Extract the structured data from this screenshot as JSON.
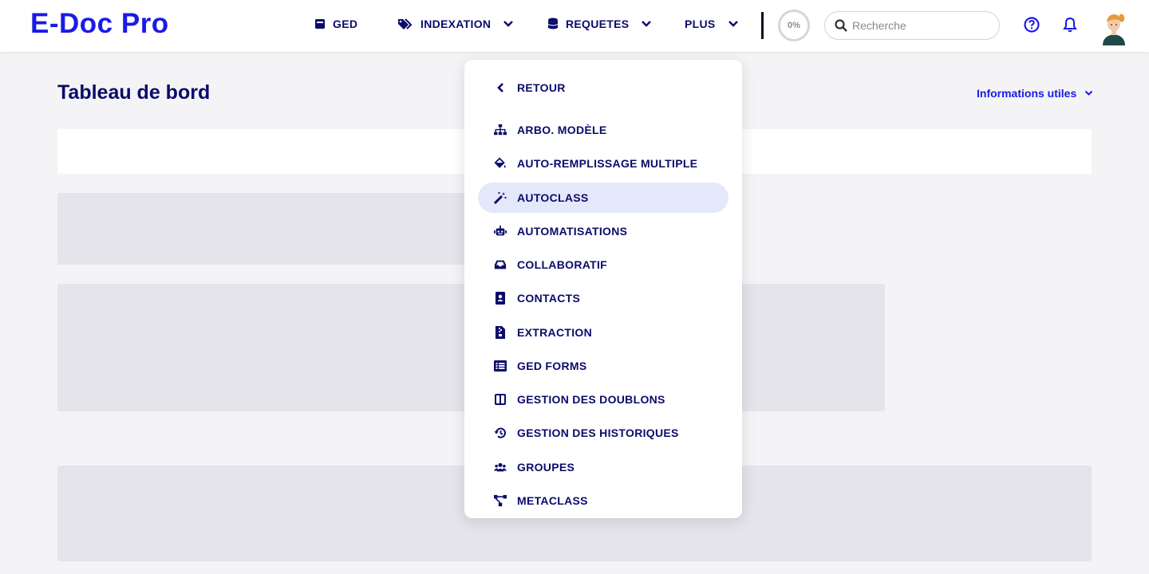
{
  "app": {
    "logo": "E-Doc Pro"
  },
  "nav": {
    "ged": "GED",
    "indexation": "INDEXATION",
    "requetes": "REQUETES",
    "plus": "PLUS"
  },
  "progress": {
    "label": "0%",
    "value": 0
  },
  "search": {
    "placeholder": "Recherche"
  },
  "page": {
    "title": "Tableau de bord",
    "info_link": "Informations utiles"
  },
  "dropdown": {
    "back": "RETOUR",
    "items": [
      {
        "label": "ARBO. MODÈLE",
        "icon": "sitemap-icon",
        "active": false
      },
      {
        "label": "AUTO-REMPLISSAGE MULTIPLE",
        "icon": "fill-bucket-icon",
        "active": false
      },
      {
        "label": "AUTOCLASS",
        "icon": "magic-wand-icon",
        "active": true
      },
      {
        "label": "AUTOMATISATIONS",
        "icon": "robot-icon",
        "active": false
      },
      {
        "label": "COLLABORATIF",
        "icon": "inbox-icon",
        "active": false
      },
      {
        "label": "CONTACTS",
        "icon": "address-book-icon",
        "active": false
      },
      {
        "label": "EXTRACTION",
        "icon": "file-zip-icon",
        "active": false
      },
      {
        "label": "GED FORMS",
        "icon": "list-form-icon",
        "active": false
      },
      {
        "label": "GESTION DES DOUBLONS",
        "icon": "columns-icon",
        "active": false
      },
      {
        "label": "GESTION DES HISTORIQUES",
        "icon": "history-icon",
        "active": false
      },
      {
        "label": "GROUPES",
        "icon": "users-icon",
        "active": false
      },
      {
        "label": "METACLASS",
        "icon": "network-icon",
        "active": false
      }
    ]
  },
  "colors": {
    "brand": "#1a1ae6",
    "text_dark": "#0b0b6b",
    "active_bg": "#e4e8fb",
    "page_bg": "#f4f4f6"
  }
}
